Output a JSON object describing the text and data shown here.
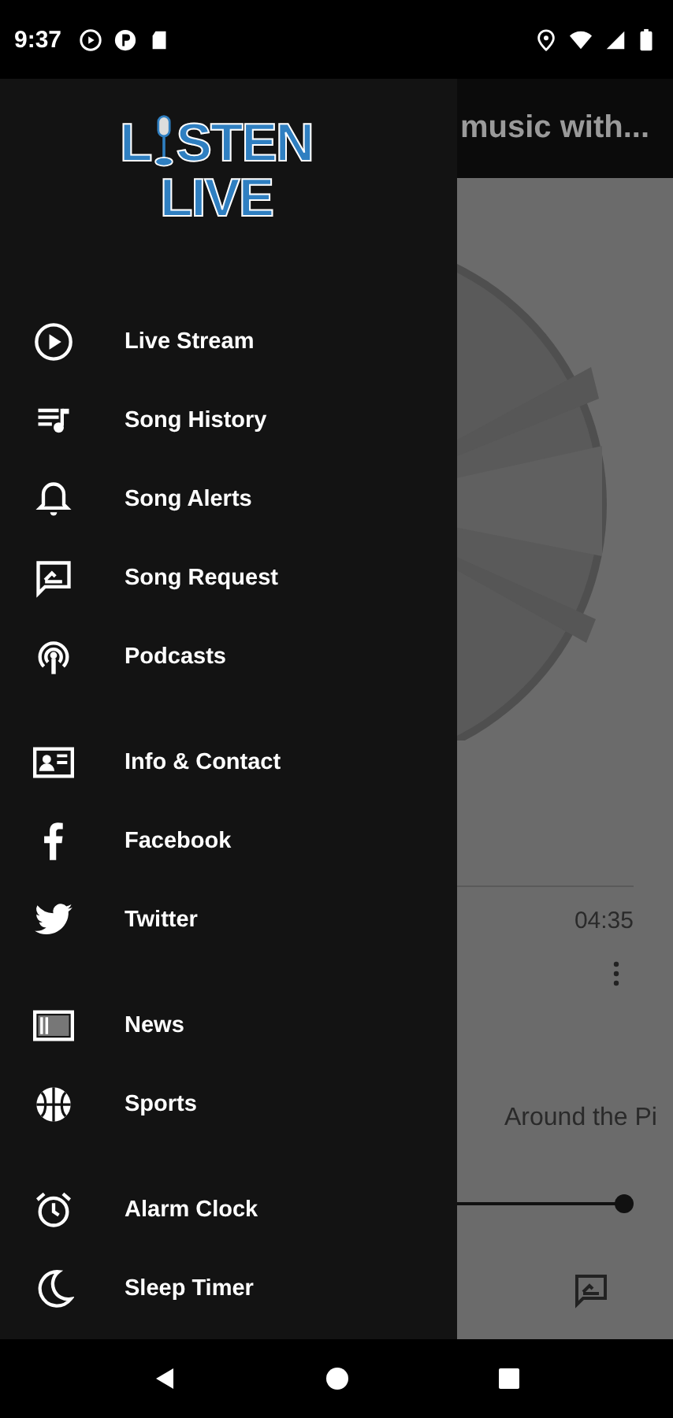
{
  "status_bar": {
    "time": "9:37"
  },
  "header": {
    "title": "music with..."
  },
  "logo": {
    "line_1_start": "L",
    "line_1_end": "STEN",
    "line_2": "LIVE"
  },
  "drawer": {
    "groups": [
      {
        "items": [
          {
            "kind": "play",
            "label": "Live Stream"
          },
          {
            "kind": "history",
            "label": "Song History"
          },
          {
            "kind": "bell",
            "label": "Song Alerts"
          },
          {
            "kind": "request",
            "label": "Song Request"
          },
          {
            "kind": "podcast",
            "label": "Podcasts"
          }
        ]
      },
      {
        "items": [
          {
            "kind": "contact",
            "label": "Info & Contact"
          },
          {
            "kind": "facebook",
            "label": "Facebook"
          },
          {
            "kind": "twitter",
            "label": "Twitter"
          }
        ]
      },
      {
        "items": [
          {
            "kind": "news",
            "label": "News"
          },
          {
            "kind": "sports",
            "label": "Sports"
          }
        ]
      },
      {
        "items": [
          {
            "kind": "alarm",
            "label": "Alarm Clock"
          },
          {
            "kind": "moon",
            "label": "Sleep Timer"
          }
        ]
      }
    ]
  },
  "player": {
    "duration": "04:35",
    "album_fragment": "Around the Pi",
    "volume": {
      "level": 0.93
    }
  }
}
